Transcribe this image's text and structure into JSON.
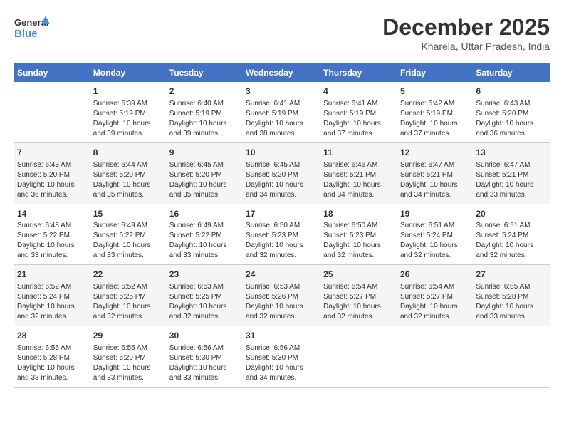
{
  "header": {
    "logo_line1": "General",
    "logo_line2": "Blue",
    "month": "December 2025",
    "location": "Kharela, Uttar Pradesh, India"
  },
  "weekdays": [
    "Sunday",
    "Monday",
    "Tuesday",
    "Wednesday",
    "Thursday",
    "Friday",
    "Saturday"
  ],
  "rows": [
    [
      {
        "num": "",
        "info": ""
      },
      {
        "num": "1",
        "info": "Sunrise: 6:39 AM\nSunset: 5:19 PM\nDaylight: 10 hours\nand 39 minutes."
      },
      {
        "num": "2",
        "info": "Sunrise: 6:40 AM\nSunset: 5:19 PM\nDaylight: 10 hours\nand 39 minutes."
      },
      {
        "num": "3",
        "info": "Sunrise: 6:41 AM\nSunset: 5:19 PM\nDaylight: 10 hours\nand 38 minutes."
      },
      {
        "num": "4",
        "info": "Sunrise: 6:41 AM\nSunset: 5:19 PM\nDaylight: 10 hours\nand 37 minutes."
      },
      {
        "num": "5",
        "info": "Sunrise: 6:42 AM\nSunset: 5:19 PM\nDaylight: 10 hours\nand 37 minutes."
      },
      {
        "num": "6",
        "info": "Sunrise: 6:43 AM\nSunset: 5:20 PM\nDaylight: 10 hours\nand 36 minutes."
      }
    ],
    [
      {
        "num": "7",
        "info": "Sunrise: 6:43 AM\nSunset: 5:20 PM\nDaylight: 10 hours\nand 36 minutes."
      },
      {
        "num": "8",
        "info": "Sunrise: 6:44 AM\nSunset: 5:20 PM\nDaylight: 10 hours\nand 35 minutes."
      },
      {
        "num": "9",
        "info": "Sunrise: 6:45 AM\nSunset: 5:20 PM\nDaylight: 10 hours\nand 35 minutes."
      },
      {
        "num": "10",
        "info": "Sunrise: 6:45 AM\nSunset: 5:20 PM\nDaylight: 10 hours\nand 34 minutes."
      },
      {
        "num": "11",
        "info": "Sunrise: 6:46 AM\nSunset: 5:21 PM\nDaylight: 10 hours\nand 34 minutes."
      },
      {
        "num": "12",
        "info": "Sunrise: 6:47 AM\nSunset: 5:21 PM\nDaylight: 10 hours\nand 34 minutes."
      },
      {
        "num": "13",
        "info": "Sunrise: 6:47 AM\nSunset: 5:21 PM\nDaylight: 10 hours\nand 33 minutes."
      }
    ],
    [
      {
        "num": "14",
        "info": "Sunrise: 6:48 AM\nSunset: 5:22 PM\nDaylight: 10 hours\nand 33 minutes."
      },
      {
        "num": "15",
        "info": "Sunrise: 6:49 AM\nSunset: 5:22 PM\nDaylight: 10 hours\nand 33 minutes."
      },
      {
        "num": "16",
        "info": "Sunrise: 6:49 AM\nSunset: 5:22 PM\nDaylight: 10 hours\nand 33 minutes."
      },
      {
        "num": "17",
        "info": "Sunrise: 6:50 AM\nSunset: 5:23 PM\nDaylight: 10 hours\nand 32 minutes."
      },
      {
        "num": "18",
        "info": "Sunrise: 6:50 AM\nSunset: 5:23 PM\nDaylight: 10 hours\nand 32 minutes."
      },
      {
        "num": "19",
        "info": "Sunrise: 6:51 AM\nSunset: 5:24 PM\nDaylight: 10 hours\nand 32 minutes."
      },
      {
        "num": "20",
        "info": "Sunrise: 6:51 AM\nSunset: 5:24 PM\nDaylight: 10 hours\nand 32 minutes."
      }
    ],
    [
      {
        "num": "21",
        "info": "Sunrise: 6:52 AM\nSunset: 5:24 PM\nDaylight: 10 hours\nand 32 minutes."
      },
      {
        "num": "22",
        "info": "Sunrise: 6:52 AM\nSunset: 5:25 PM\nDaylight: 10 hours\nand 32 minutes."
      },
      {
        "num": "23",
        "info": "Sunrise: 6:53 AM\nSunset: 5:25 PM\nDaylight: 10 hours\nand 32 minutes."
      },
      {
        "num": "24",
        "info": "Sunrise: 6:53 AM\nSunset: 5:26 PM\nDaylight: 10 hours\nand 32 minutes."
      },
      {
        "num": "25",
        "info": "Sunrise: 6:54 AM\nSunset: 5:27 PM\nDaylight: 10 hours\nand 32 minutes."
      },
      {
        "num": "26",
        "info": "Sunrise: 6:54 AM\nSunset: 5:27 PM\nDaylight: 10 hours\nand 32 minutes."
      },
      {
        "num": "27",
        "info": "Sunrise: 6:55 AM\nSunset: 5:28 PM\nDaylight: 10 hours\nand 33 minutes."
      }
    ],
    [
      {
        "num": "28",
        "info": "Sunrise: 6:55 AM\nSunset: 5:28 PM\nDaylight: 10 hours\nand 33 minutes."
      },
      {
        "num": "29",
        "info": "Sunrise: 6:55 AM\nSunset: 5:29 PM\nDaylight: 10 hours\nand 33 minutes."
      },
      {
        "num": "30",
        "info": "Sunrise: 6:56 AM\nSunset: 5:30 PM\nDaylight: 10 hours\nand 33 minutes."
      },
      {
        "num": "31",
        "info": "Sunrise: 6:56 AM\nSunset: 5:30 PM\nDaylight: 10 hours\nand 34 minutes."
      },
      {
        "num": "",
        "info": ""
      },
      {
        "num": "",
        "info": ""
      },
      {
        "num": "",
        "info": ""
      }
    ]
  ]
}
